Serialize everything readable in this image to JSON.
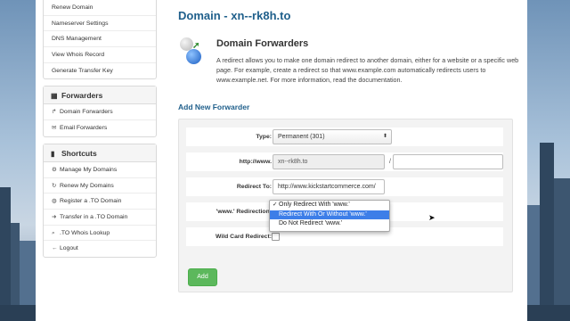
{
  "sidebar": {
    "domain_items": [
      {
        "label": "Renew Domain"
      },
      {
        "label": "Nameserver Settings"
      },
      {
        "label": "DNS Management"
      },
      {
        "label": "View Whois Record"
      },
      {
        "label": "Generate Transfer Key"
      }
    ],
    "forwarders": {
      "title": "Forwarders",
      "items": [
        {
          "label": "Domain Forwarders",
          "icon": "share-arrow-icon"
        },
        {
          "label": "Email Forwarders",
          "icon": "envelope-icon"
        }
      ]
    },
    "shortcuts": {
      "title": "Shortcuts",
      "items": [
        {
          "label": "Manage My Domains",
          "icon": "gear-icon"
        },
        {
          "label": "Renew My Domains",
          "icon": "refresh-icon"
        },
        {
          "label": "Register a .TO Domain",
          "icon": "globe-icon"
        },
        {
          "label": "Transfer in a .TO Domain",
          "icon": "transfer-icon"
        },
        {
          "label": ".TO Whois Lookup",
          "icon": "search-icon"
        },
        {
          "label": "Logout",
          "icon": "logout-icon"
        }
      ]
    }
  },
  "main": {
    "title": "Domain - xn--rk8h.to",
    "heading": "Domain Forwarders",
    "description": "A redirect allows you to make one domain redirect to another domain, either for a website or a specific web page. For example, create a redirect so that www.example.com automatically redirects users to www.example.net. For more information, read the documentation.",
    "subheading": "Add New Forwarder"
  },
  "form": {
    "type_label": "Type:",
    "type_value": "Permanent (301)",
    "http_label": "http://www.",
    "domain_value": "xn--rk8h.to",
    "slash": "/",
    "path_value": "",
    "redirect_label": "Redirect To:",
    "redirect_value": "http://www.kickstartcommerce.com/",
    "www_label": "'www.' Redirection:",
    "www_options": [
      {
        "label": "Only Redirect With 'www.'",
        "selected": true,
        "highlighted": false
      },
      {
        "label": "Redirect With Or Without 'www.'",
        "selected": false,
        "highlighted": true
      },
      {
        "label": "Do Not Redirect 'www.'",
        "selected": false,
        "highlighted": false
      }
    ],
    "wildcard_label": "Wild Card Redirect:",
    "add_button": "Add"
  },
  "colors": {
    "title": "#1f5f8b",
    "add_button": "#5cb85c",
    "highlight": "#3d7ee8"
  }
}
